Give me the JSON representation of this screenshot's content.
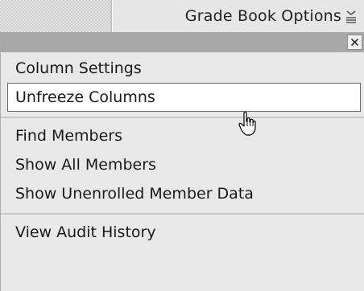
{
  "toolbar": {
    "tab_label": "Grade Book Options",
    "tab_icon": "menu-dropdown-icon"
  },
  "menu": {
    "close_icon": "close-icon",
    "close_label": "×",
    "groups": [
      {
        "items": [
          {
            "label": "Column Settings"
          },
          {
            "label": "Unfreeze Columns",
            "state": "hovered"
          }
        ]
      },
      {
        "items": [
          {
            "label": "Find Members"
          },
          {
            "label": "Show All Members"
          },
          {
            "label": "Show Unenrolled Member Data"
          }
        ]
      },
      {
        "items": [
          {
            "label": "View Audit History"
          }
        ]
      }
    ]
  },
  "cursor": {
    "icon": "hand-pointer-icon"
  },
  "colors": {
    "header_bar": "#a8a8a8",
    "panel_bg": "#e8e8e8",
    "hover_bg": "#ffffff",
    "text": "#1a1a1a"
  }
}
